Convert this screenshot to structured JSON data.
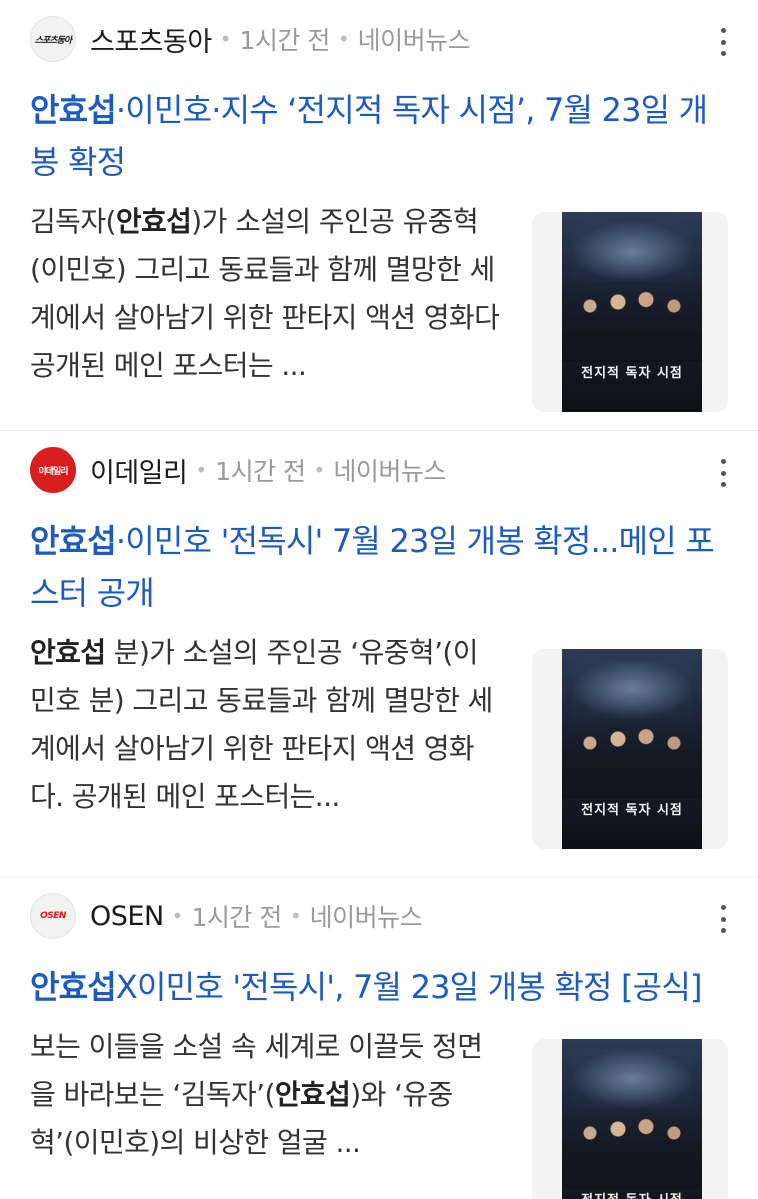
{
  "articles": [
    {
      "source": "스포츠동아",
      "logo_text": "스포츠동아",
      "time": "1시간 전",
      "platform": "네이버뉴스",
      "headline_bold": "안효섭",
      "headline_rest": "·이민호·지수 ‘전지적 독자 시점’, 7월 23일 개봉 확정",
      "snippet_pre": "김독자(",
      "snippet_bold": "안효섭",
      "snippet_post": ")가 소설의 주인공 유중혁(이민호) 그리고 동료들과 함께 멸망한 세계에서 살아남기 위한 판타지 액션 영화다 공개된 메인 포스터는 ...",
      "thumb_title": "전지적 독자 시점"
    },
    {
      "source": "이데일리",
      "logo_text": "이데일리",
      "time": "1시간 전",
      "platform": "네이버뉴스",
      "headline_bold": "안효섭",
      "headline_rest": "·이민호 '전독시' 7월 23일 개봉 확정...메인 포스터 공개",
      "snippet_pre": "",
      "snippet_bold": "안효섭",
      "snippet_post": " 분)가 소설의 주인공 ‘유중혁’(이민호 분) 그리고 동료들과 함께 멸망한 세계에서 살아남기 위한 판타지 액션 영화다. 공개된 메인 포스터는...",
      "thumb_title": "전지적 독자 시점"
    },
    {
      "source": "OSEN",
      "logo_text": "OSEN",
      "time": "1시간 전",
      "platform": "네이버뉴스",
      "headline_bold": "안효섭",
      "headline_rest": "X이민호 '전독시', 7월 23일 개봉 확정 [공식]",
      "snippet_pre": "보는 이들을 소설 속 세계로 이끌듯 정면을 바라보는 ‘김독자’(",
      "snippet_bold": "안효섭",
      "snippet_post": ")와 ‘유중혁’(이민호)의 비상한 얼굴 ...",
      "thumb_title": "전지적 독자 시점"
    }
  ]
}
